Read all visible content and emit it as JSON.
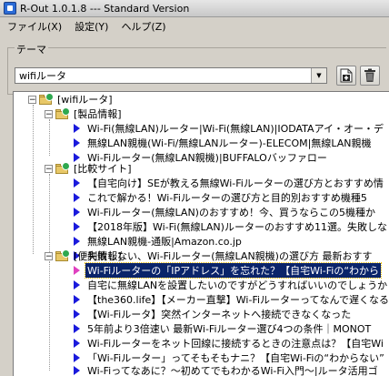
{
  "window": {
    "title": "R-Out 1.0.1.8 --- Standard Version"
  },
  "menu": [
    {
      "label": "ファイル(X)"
    },
    {
      "label": "設定(Y)"
    },
    {
      "label": "ヘルプ(Z)"
    }
  ],
  "theme": {
    "legend": "テーマ",
    "selected": "wifiルータ",
    "add_icon": "add-document-icon",
    "delete_icon": "trash-icon"
  },
  "tree": {
    "root": {
      "label": "[wifiルータ]"
    },
    "folders": [
      {
        "label": "[製品情報]",
        "items": [
          {
            "label": "Wi-Fi(無線LAN)ルーター|Wi-Fi(無線LAN)|IODATAアイ・オー・デ"
          },
          {
            "label": "無線LAN親機(Wi-Fi/無線LANルーター)-ELECOM|無線LAN親機"
          },
          {
            "label": "Wi-Fiルーター(無線LAN親機)|BUFFALOバッファロー"
          }
        ]
      },
      {
        "label": "[比較サイト]",
        "items": [
          {
            "label": "【自宅向け】SEが教える無線Wi-Fiルーターの選び方とおすすめ情"
          },
          {
            "label": "これで解かる！Wi-Fiルーターの選び方と目的別おすすめ機種5"
          },
          {
            "label": "Wi-Fiルーター(無線LAN)のおすすめ！今、買うならこの5機種か"
          },
          {
            "label": "【2018年版】Wi-Fi(無線LAN)ルーターのおすすめ11選。失敗しな"
          },
          {
            "label": "無線LAN親機-通販|Amazon.co.jp"
          },
          {
            "label": "失敗しない、Wi-Fiルーター(無線LAN親機)の選び方 最新おすす"
          }
        ]
      },
      {
        "label": "[便利情報]",
        "items": [
          {
            "label": "Wi-Fiルーターの「IPアドレス」を忘れた？【自宅Wi-Fiの“わから",
            "selected": true,
            "color": "pink"
          },
          {
            "label": "自宅に無線LANを設置したいのですがどうすればいいのでしょうか"
          },
          {
            "label": "【the360.life】【メーカー直撃】Wi-Fiルーターってなんで遅くなるん"
          },
          {
            "label": "【Wi-Fiルータ】突然インターネットへ接続できなくなった"
          },
          {
            "label": "5年前より3倍速い 最新Wi-Fiルーター選び4つの条件｜MONOT"
          },
          {
            "label": "Wi-Fiルーターをネット回線に接続するときの注意点は？【自宅Wi"
          },
          {
            "label": "「Wi-Fiルーター」ってそもそもナニ？【自宅Wi-Fiの“わからない”"
          },
          {
            "label": "Wi-Fiってなあに？～初めてでもわかるWi-Fi入門～|ルータ活用ゴ"
          }
        ]
      }
    ]
  },
  "colors": {
    "window_bg": "#d4d0c8",
    "selection_bg": "#0a246a",
    "bullet_blue": "#1a1adc",
    "bullet_pink": "#e040c0",
    "folder": "#e8c868",
    "folder_badge": "#2fa84f"
  }
}
